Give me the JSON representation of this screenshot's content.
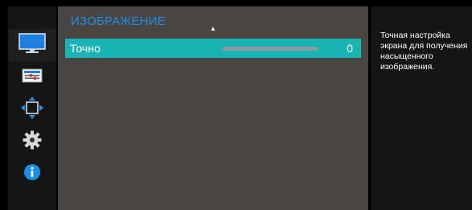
{
  "menu": {
    "title": "ИЗОБРАЖЕНИЕ",
    "row": {
      "label": "Точно",
      "value": "0",
      "level": 0
    }
  },
  "sidebar": {
    "items": [
      {
        "icon": "monitor-picture-icon",
        "active": true
      },
      {
        "icon": "onscreen-display-icon",
        "active": false
      },
      {
        "icon": "position-size-icon",
        "active": false
      },
      {
        "icon": "gear-icon",
        "active": false
      },
      {
        "icon": "info-icon",
        "active": false
      }
    ]
  },
  "help": {
    "text": "Точная настройка экрана для получения насыщенного изображения."
  },
  "colors": {
    "title": "#1a8fe8",
    "highlight": "#1ab4b4",
    "panel": "#4a4644",
    "info": "#1a8fe8"
  }
}
